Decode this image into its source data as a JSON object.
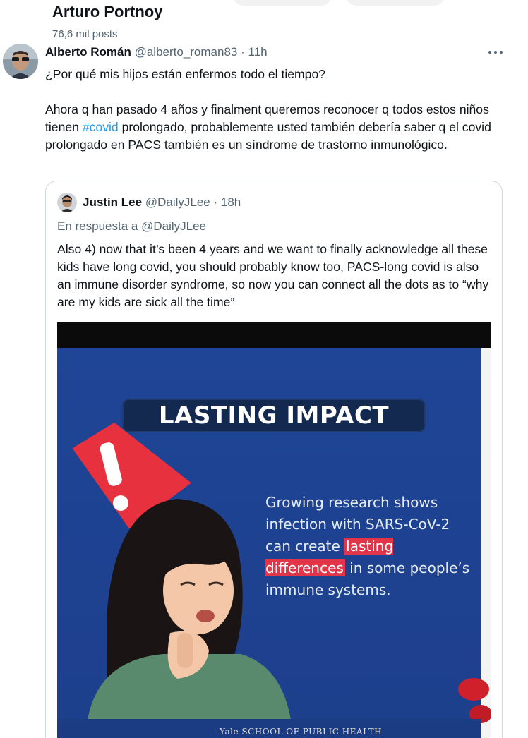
{
  "header": {
    "title": "Arturo Portnoy",
    "post_count": "76,6 mil posts"
  },
  "tweet": {
    "author_name": "Alberto Román",
    "author_handle": "@alberto_roman83",
    "time": "11h",
    "line1": "¿Por qué mis hijos están enfermos todo el tiempo?",
    "body_before": "Ahora q han pasado 4 años y finalment queremos reconocer q todos estos niños tienen ",
    "hashtag": "#covid",
    "body_after": " prolongado, probablemente usted también debería saber q el covid prolongado en PACS también es un síndrome de trastorno inmunológico.",
    "more_icon": "more-horizontal-icon"
  },
  "quoted": {
    "author_name": "Justin Lee",
    "author_handle": "@DailyJLee",
    "time": "18h",
    "reply_prefix": "En respuesta a",
    "reply_handle": "@DailyJLee",
    "text": "Also 4) now that it’s been 4 years and we want to finally acknowledge all these kids have long covid, you should probably know too, PACS-long covid is also an immune disorder syndrome, so now you can connect all the dots as to “why are my kids are sick all the time”",
    "image": {
      "headline": "LASTING IMPACT",
      "body_before": "Growing research shows infection with SARS-CoV-2 can create ",
      "highlight": "lasting differences",
      "body_after": " in some people’s immune systems.",
      "footer": "Yale SCHOOL OF PUBLIC HEALTH",
      "colors": {
        "background": "#1f4b9e",
        "highlight": "#e3354a",
        "warning": "#e8313f"
      }
    }
  }
}
